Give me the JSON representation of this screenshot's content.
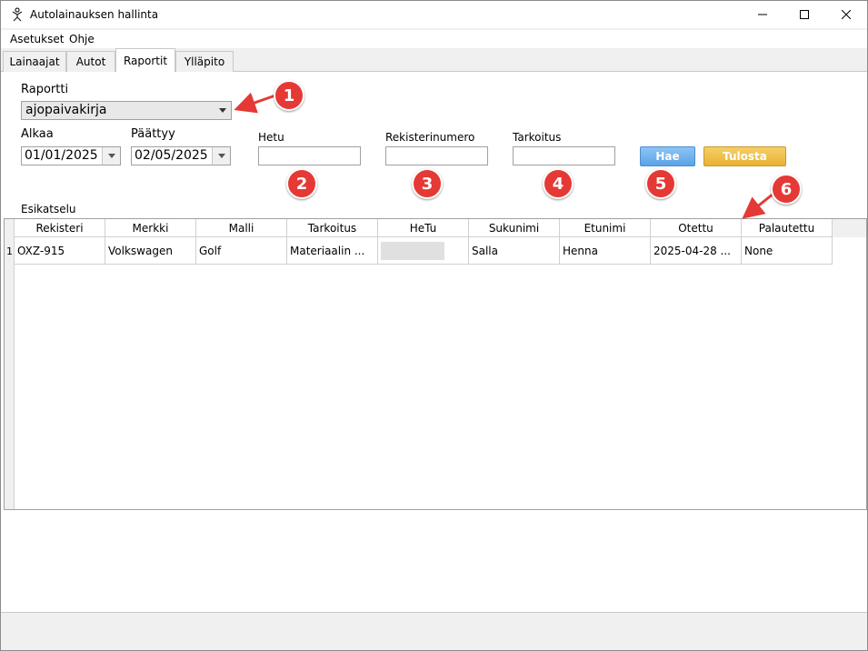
{
  "window": {
    "title": "Autolainauksen hallinta"
  },
  "menu": [
    "Asetukset",
    "Ohje"
  ],
  "tabs": [
    "Lainaajat",
    "Autot",
    "Raportit",
    "Ylläpito"
  ],
  "active_tab": "Raportit",
  "form": {
    "report_label": "Raportti",
    "report_value": "ajopaivakirja",
    "start_label": "Alkaa",
    "start_value": "01/01/2025",
    "end_label": "Päättyy",
    "end_value": "02/05/2025",
    "hetu_label": "Hetu",
    "hetu_value": "",
    "reg_label": "Rekisterinumero",
    "reg_value": "",
    "purpose_label": "Tarkoitus",
    "purpose_value": "",
    "search_button": "Hae",
    "print_button": "Tulosta",
    "preview_label": "Esikatselu"
  },
  "badges": [
    "1",
    "2",
    "3",
    "4",
    "5",
    "6"
  ],
  "table": {
    "columns": [
      "Rekisteri",
      "Merkki",
      "Malli",
      "Tarkoitus",
      "HeTu",
      "Sukunimi",
      "Etunimi",
      "Otettu",
      "Palautettu"
    ],
    "rows": [
      {
        "index": "1",
        "cells": [
          "OXZ-915",
          "Volkswagen",
          "Golf",
          "Materiaalin ...",
          "",
          "Salla",
          "Henna",
          "2025-04-28 ...",
          "None"
        ]
      }
    ]
  },
  "colors": {
    "badge": "#e53935",
    "hae": "#5aa3e6",
    "tulosta": "#e8b232",
    "arrow": "#e53935"
  }
}
